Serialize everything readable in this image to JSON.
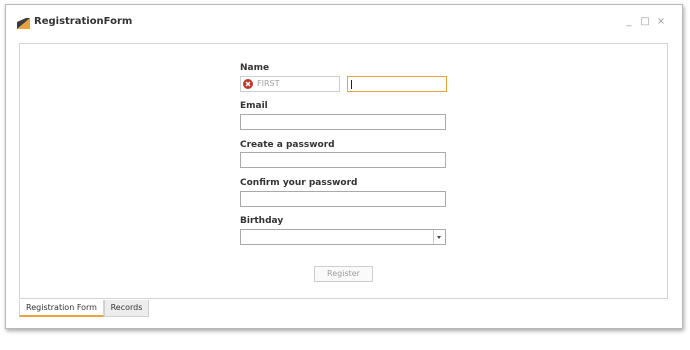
{
  "window": {
    "title": "RegistrationForm",
    "controls": {
      "minimize": "_",
      "maximize": "□",
      "close": "×"
    }
  },
  "form": {
    "name_label": "Name",
    "first_placeholder": "FIRST",
    "first_value": "",
    "last_value": "",
    "email_label": "Email",
    "email_value": "",
    "password_label": "Create a password",
    "password_value": "",
    "confirm_label": "Confirm your password",
    "confirm_value": "",
    "birthday_label": "Birthday",
    "birthday_value": "",
    "register_label": "Register"
  },
  "tabs": [
    {
      "label": "Registration Form",
      "active": true
    },
    {
      "label": "Records",
      "active": false
    }
  ],
  "colors": {
    "accent": "#e8a33c",
    "error": "#c0392b",
    "border": "#a9a9a9"
  },
  "icons": {
    "app": "app-logo-icon",
    "error": "error-icon",
    "dropdown": "chevron-down-icon"
  }
}
